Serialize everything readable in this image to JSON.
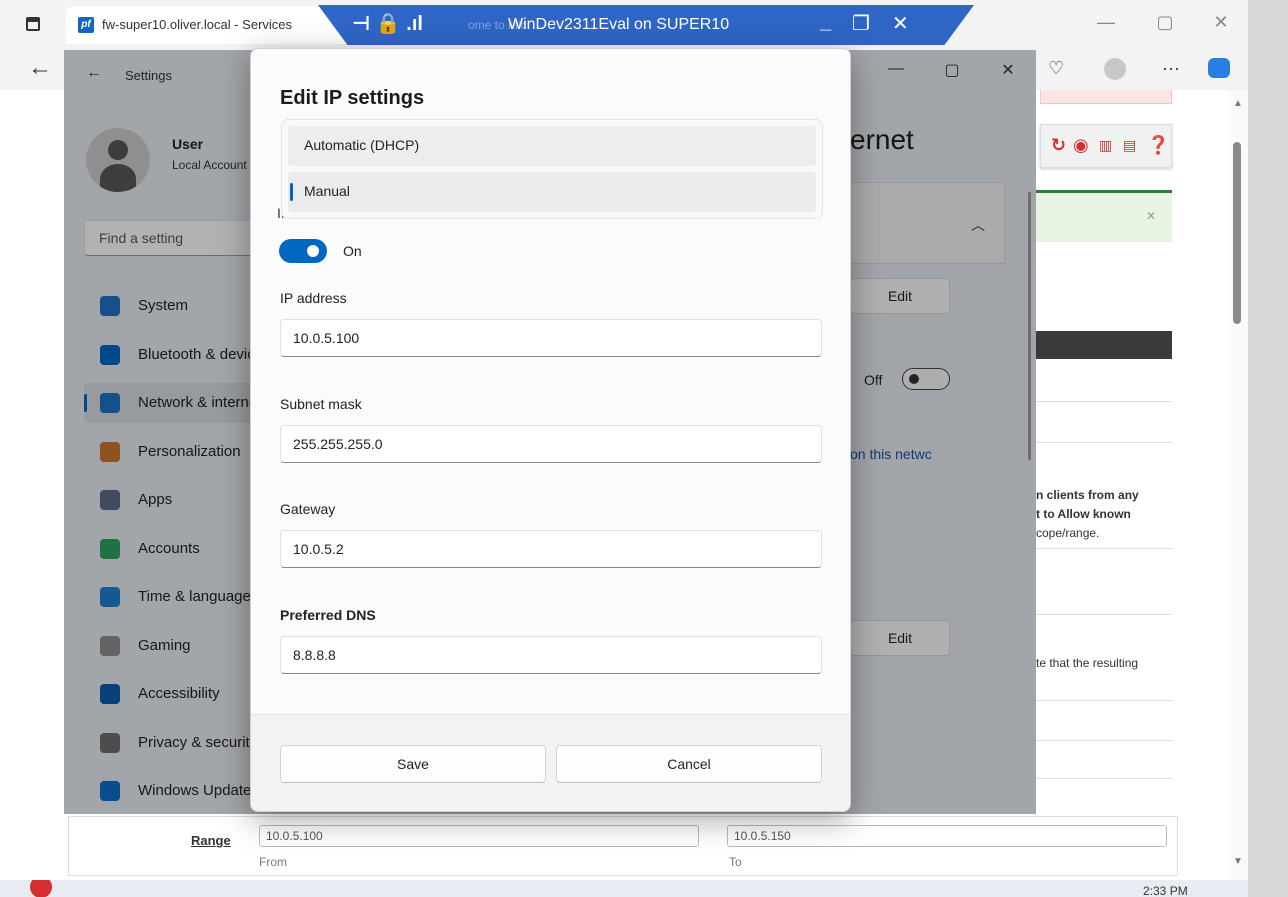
{
  "browser": {
    "tab_title": "fw-super10.oliver.local - Services",
    "tab_favicon": "pf",
    "tab_peek": "ome to Mic"
  },
  "rdp": {
    "title": "WinDev2311Eval on SUPER10"
  },
  "settings": {
    "window_title": "Settings",
    "user_name": "User",
    "user_sub": "Local Account",
    "search_placeholder": "Find a setting",
    "nav": [
      {
        "label": "System",
        "icon": "system-icon",
        "color": "#1f6fbf"
      },
      {
        "label": "Bluetooth & devices",
        "icon": "bluetooth-icon",
        "color": "#0067c0"
      },
      {
        "label": "Network & internet",
        "icon": "wifi-icon",
        "color": "#1f6fbf",
        "active": true
      },
      {
        "label": "Personalization",
        "icon": "brush-icon",
        "color": "#c4742b"
      },
      {
        "label": "Apps",
        "icon": "apps-icon",
        "color": "#5a6a86"
      },
      {
        "label": "Accounts",
        "icon": "accounts-icon",
        "color": "#2e9d5c"
      },
      {
        "label": "Time & language",
        "icon": "globe-clock-icon",
        "color": "#1f7ac8"
      },
      {
        "label": "Gaming",
        "icon": "gamepad-icon",
        "color": "#8a8a8a"
      },
      {
        "label": "Accessibility",
        "icon": "accessibility-icon",
        "color": "#0b5aa6"
      },
      {
        "label": "Privacy & security",
        "icon": "shield-icon",
        "color": "#6b6b6b"
      },
      {
        "label": "Windows Update",
        "icon": "update-icon",
        "color": "#0a6cc7"
      }
    ],
    "page_title_fragment": "ernet",
    "edit_label": "Edit",
    "off_label": "Off",
    "network_link_fragment": "on this netwc"
  },
  "dialog": {
    "title": "Edit IP settings",
    "options": [
      "Automatic (DHCP)",
      "Manual"
    ],
    "selected_option": "Manual",
    "toggle_label": "On",
    "fields": {
      "ip_label": "IP address",
      "ip_value": "10.0.5.100",
      "subnet_label": "Subnet mask",
      "subnet_value": "255.255.255.0",
      "gateway_label": "Gateway",
      "gateway_value": "10.0.5.2",
      "dns_label": "Preferred DNS",
      "dns_value": "8.8.8.8"
    },
    "save_label": "Save",
    "cancel_label": "Cancel"
  },
  "webpage": {
    "text_lines": [
      {
        "text": "n clients from any",
        "bold": true
      },
      {
        "text": "t to Allow known",
        "bold": true
      },
      {
        "text": "cope/range.",
        "bold": false
      }
    ],
    "text_line_2": "te that the resulting",
    "range_label": "Range",
    "range_from": "10.0.5.100",
    "range_from_sub": "From",
    "range_to": "10.0.5.150",
    "range_to_sub": "To"
  },
  "taskbar": {
    "clock": "2:33 PM"
  }
}
